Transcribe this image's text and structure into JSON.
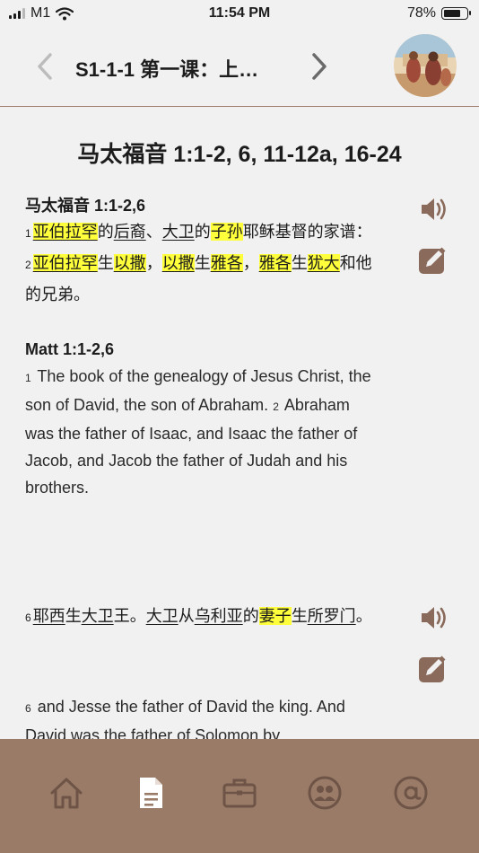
{
  "status_bar": {
    "carrier": "M1",
    "time": "11:54 PM",
    "battery": "78%",
    "battery_level": 0.78
  },
  "nav": {
    "title": "S1-1-1 第一课：上…"
  },
  "passage": {
    "title": "马太福音 1:1-2, 6, 11-12a, 16-24",
    "zh1_heading": "马太福音 1:1-2,6",
    "en1_heading": "Matt 1:1-2,6",
    "en1_text": "The book of the genealogy of Jesus Christ, the son of David, the son of Abraham.",
    "en2_text": "Abraham was the father of Isaac, and Isaac the father of Jacob, and Jacob the father of Judah and his brothers.",
    "en6_text": "and Jesse the father of David the king. And David was the father of Solomon by"
  },
  "zh_tokens": {
    "v1": "1",
    "t1": "亚伯拉罕",
    "t2": "的",
    "t3": "后裔",
    "t4": "、",
    "t5": "大卫",
    "t6": "的",
    "t7": "子孙",
    "t8": "耶稣基督的家谱：",
    "v2": "2",
    "t9": "亚伯拉罕",
    "t10": "生",
    "t11": "以撒",
    "t12": "，",
    "t13": "以撒",
    "t14": "生",
    "t15": "雅各",
    "t16": "，",
    "t17": "雅各",
    "t18": "生",
    "t19": "犹大",
    "t20": "和他的兄弟。"
  },
  "zh6_tokens": {
    "v6": "6",
    "t1": "耶西",
    "t2": "生",
    "t3": "大卫",
    "t4": "王",
    "t5": "。",
    "t6": "大卫",
    "t7": "从",
    "t8": "乌利亚",
    "t9": "的",
    "t10": "妻子",
    "t11": "生",
    "t12": "所罗门",
    "t13": "。"
  },
  "verse_numbers": {
    "en1": "1",
    "en2": "2",
    "en6": "6"
  },
  "icons": {
    "speaker": "speaker-icon",
    "note": "edit-note-icon",
    "tabs": [
      "home-icon",
      "document-icon",
      "briefcase-icon",
      "group-icon",
      "at-sign-icon"
    ]
  },
  "colors": {
    "accent": "#9a7b68",
    "icon": "#8a6a5a",
    "highlight": "#ffff3b"
  }
}
